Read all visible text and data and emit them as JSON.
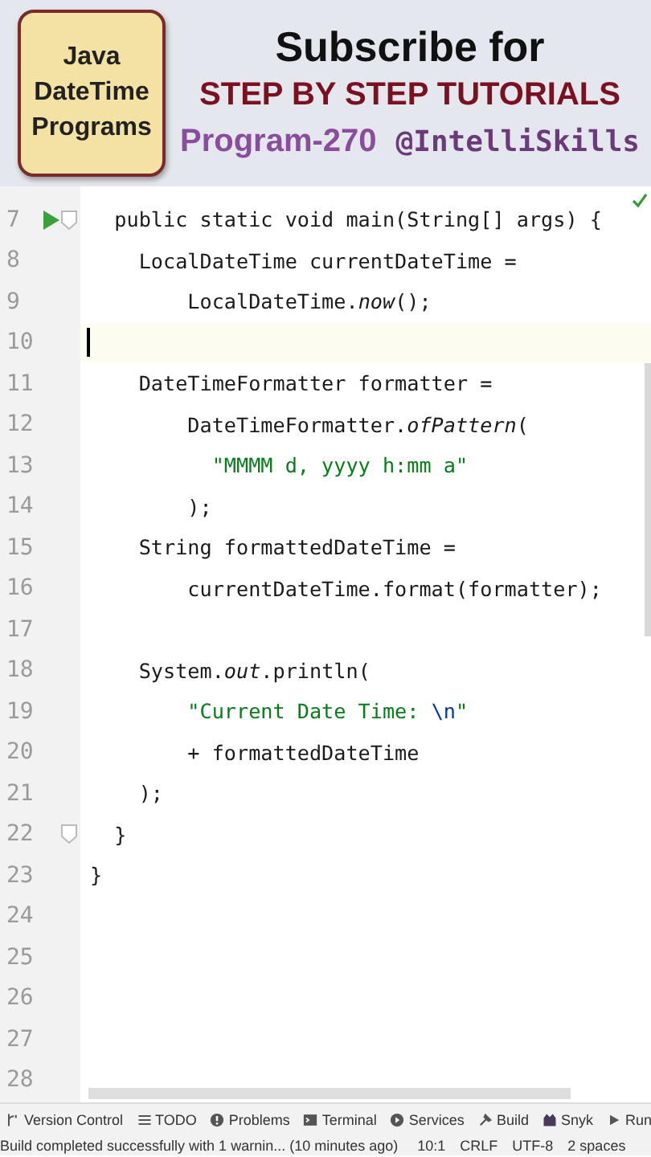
{
  "banner": {
    "badge_lines": [
      "Java",
      "DateTime",
      "Programs"
    ],
    "headline": "Subscribe for",
    "subheadline": "STEP BY STEP TUTORIALS",
    "program": "Program-270",
    "handle": "@IntelliSkills"
  },
  "editor": {
    "lines": [
      {
        "number": "7",
        "run": true,
        "fold": true,
        "current": false,
        "tokens": [
          {
            "kind": "code",
            "text": "  public static void main(String[] args) {"
          }
        ]
      },
      {
        "number": "8",
        "run": false,
        "fold": false,
        "current": false,
        "tokens": [
          {
            "kind": "code",
            "text": "    LocalDateTime currentDateTime ="
          }
        ]
      },
      {
        "number": "9",
        "run": false,
        "fold": false,
        "current": false,
        "tokens": [
          {
            "kind": "code",
            "text": "        LocalDateTime."
          },
          {
            "kind": "italic",
            "text": "now"
          },
          {
            "kind": "code",
            "text": "();"
          }
        ]
      },
      {
        "number": "10",
        "run": false,
        "fold": false,
        "current": true
      },
      {
        "number": "11",
        "run": false,
        "fold": false,
        "current": false,
        "tokens": [
          {
            "kind": "code",
            "text": "    DateTimeFormatter formatter ="
          }
        ]
      },
      {
        "number": "12",
        "run": false,
        "fold": false,
        "current": false,
        "tokens": [
          {
            "kind": "code",
            "text": "        DateTimeFormatter."
          },
          {
            "kind": "italic",
            "text": "ofPattern"
          },
          {
            "kind": "code",
            "text": "("
          }
        ]
      },
      {
        "number": "13",
        "run": false,
        "fold": false,
        "current": false,
        "tokens": [
          {
            "kind": "string",
            "text": "          \"MMMM d, yyyy h:mm a\""
          }
        ]
      },
      {
        "number": "14",
        "run": false,
        "fold": false,
        "current": false,
        "tokens": [
          {
            "kind": "code",
            "text": "        );"
          }
        ]
      },
      {
        "number": "15",
        "run": false,
        "fold": false,
        "current": false,
        "tokens": [
          {
            "kind": "code",
            "text": "    String formattedDateTime ="
          }
        ]
      },
      {
        "number": "16",
        "run": false,
        "fold": false,
        "current": false,
        "tokens": [
          {
            "kind": "code",
            "text": "        currentDateTime.format(formatter);"
          }
        ]
      },
      {
        "number": "17",
        "run": false,
        "fold": false,
        "current": false
      },
      {
        "number": "18",
        "run": false,
        "fold": false,
        "current": false,
        "tokens": [
          {
            "kind": "code",
            "text": "    System."
          },
          {
            "kind": "italic",
            "text": "out"
          },
          {
            "kind": "code",
            "text": ".println("
          }
        ]
      },
      {
        "number": "19",
        "run": false,
        "fold": false,
        "current": false,
        "tokens": [
          {
            "kind": "string",
            "text": "        \"Current Date Time: "
          },
          {
            "kind": "escape",
            "text": "\\n"
          },
          {
            "kind": "string",
            "text": "\""
          }
        ]
      },
      {
        "number": "20",
        "run": false,
        "fold": false,
        "current": false,
        "tokens": [
          {
            "kind": "code",
            "text": "        + formattedDateTime"
          }
        ]
      },
      {
        "number": "21",
        "run": false,
        "fold": false,
        "current": false,
        "tokens": [
          {
            "kind": "code",
            "text": "    );"
          }
        ]
      },
      {
        "number": "22",
        "run": false,
        "fold": true,
        "current": false,
        "tokens": [
          {
            "kind": "code",
            "text": "  }"
          }
        ]
      },
      {
        "number": "23",
        "run": false,
        "fold": false,
        "current": false,
        "tokens": [
          {
            "kind": "code",
            "text": "}"
          }
        ]
      },
      {
        "number": "24",
        "run": false,
        "fold": false,
        "current": false
      },
      {
        "number": "25",
        "run": false,
        "fold": false,
        "current": false
      },
      {
        "number": "26",
        "run": false,
        "fold": false,
        "current": false
      },
      {
        "number": "27",
        "run": false,
        "fold": false,
        "current": false
      },
      {
        "number": "28",
        "run": false,
        "fold": false,
        "current": false
      }
    ]
  },
  "tool_windows": [
    {
      "kind": "vcs",
      "label": "Version Control"
    },
    {
      "kind": "todo",
      "label": "TODO"
    },
    {
      "kind": "problems",
      "label": "Problems"
    },
    {
      "kind": "terminal",
      "label": "Terminal"
    },
    {
      "kind": "services",
      "label": "Services"
    },
    {
      "kind": "build",
      "label": "Build"
    },
    {
      "kind": "snyk",
      "label": "Snyk"
    },
    {
      "kind": "run",
      "label": "Run"
    }
  ],
  "status_bar": {
    "message": "Build completed successfully with 1 warnin... (10 minutes ago)",
    "items": [
      "10:1",
      "CRLF",
      "UTF-8",
      "2 spaces"
    ]
  }
}
